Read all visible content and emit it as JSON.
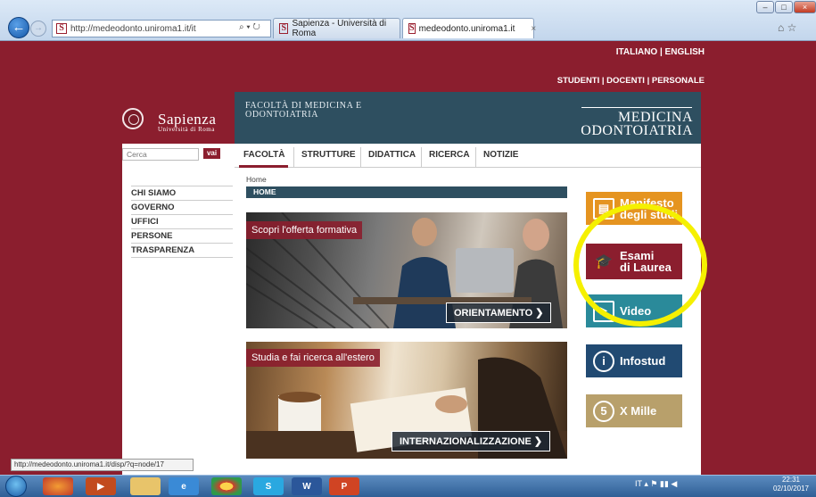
{
  "browser": {
    "address": "http://medeodonto.uniroma1.it/it",
    "tabs": [
      {
        "label": "Sapienza - Università di Roma"
      },
      {
        "label": "medeodonto.uniroma1.it"
      }
    ],
    "addr_tools": "⌕ ▾ ↻",
    "close_glyph": "×",
    "status_url": "http://medeodonto.uniroma1.it/disp/?q=node/17"
  },
  "page": {
    "langs": "ITALIANO | ENGLISH",
    "userlinks": "STUDENTI | DOCENTI | PERSONALE",
    "sapienza_name": "Sapienza",
    "sapienza_sub": "Università di Roma",
    "faculty_label": "Facoltà di Medicina e Odontoiatria",
    "header_title_1": "MEDICINA",
    "header_title_2": "ODONTOIATRIA",
    "search_placeholder": "Cerca",
    "search_button": "vai",
    "nav": [
      "FACOLTÀ",
      "STRUTTURE",
      "DIDATTICA",
      "RICERCA",
      "NOTIZIE"
    ],
    "sidebar": [
      "CHI SIAMO",
      "GOVERNO",
      "UFFICI",
      "PERSONE",
      "TRASPARENZA"
    ],
    "breadcrumb": "Home",
    "home_bar": "HOME",
    "promo1_tag": "Scopri l'offerta formativa",
    "promo1_btn": "ORIENTAMENTO ❯",
    "promo2_tag": "Studia e fai ricerca all'estero",
    "promo2_btn": "INTERNAZIONALIZZAZIONE ❯",
    "tiles": [
      {
        "label_1": "Manifesto",
        "label_2": "degli studi",
        "color": "#e59420"
      },
      {
        "label_1": "Esami",
        "label_2": "di Laurea",
        "color": "#8b1e2e"
      },
      {
        "label_1": "Video",
        "label_2": "",
        "color": "#2a8a9a"
      },
      {
        "label_1": "Infostud",
        "label_2": "",
        "color": "#214a72"
      },
      {
        "label_1": "X Mille",
        "label_2": "",
        "color": "#b8a06b"
      }
    ],
    "tile_icons": [
      "book-icon",
      "graduation-cap-icon",
      "video-icon",
      "info-icon",
      "five-per-mille-icon"
    ],
    "tile_icon_glyphs": [
      "▤",
      "🎓",
      "▶",
      "i",
      "5"
    ]
  },
  "taskbar": {
    "apps": [
      "firefox",
      "media",
      "explorer",
      "internet-explorer",
      "chrome",
      "skype",
      "word",
      "powerpoint"
    ],
    "tray": "IT  ▴  ⚑  ▮▮  ◀",
    "time": "22:31",
    "date": "02/10/2017"
  },
  "colors": {
    "brand": "#8b1e2e",
    "header": "#2e4f60",
    "highlight": "#f5f000"
  }
}
